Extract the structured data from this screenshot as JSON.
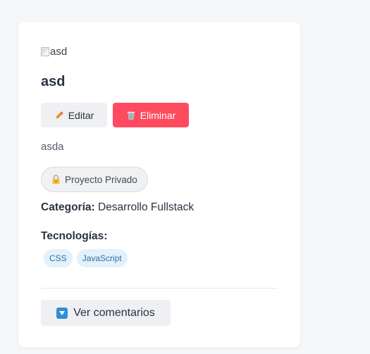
{
  "project": {
    "image_alt": "asd",
    "title": "asd",
    "description": "asda",
    "privacy_label": "Proyecto Privado",
    "category_label": "Categoría:",
    "category_value": "Desarrollo Fullstack",
    "technologies_label": "Tecnologías:",
    "technologies": [
      "CSS",
      "JavaScript"
    ]
  },
  "actions": {
    "edit_label": "Editar",
    "delete_label": "Eliminar",
    "comments_label": "Ver comentarios"
  },
  "icons": {
    "edit": "pencil-icon",
    "delete": "trash-icon",
    "privacy": "lock-icon",
    "comments": "down-arrow-icon"
  },
  "colors": {
    "delete_button": "#ff4b60",
    "tag_background": "#e3f1fc",
    "tag_text": "#2e6f9e",
    "comments_icon": "#2c8fd6"
  }
}
